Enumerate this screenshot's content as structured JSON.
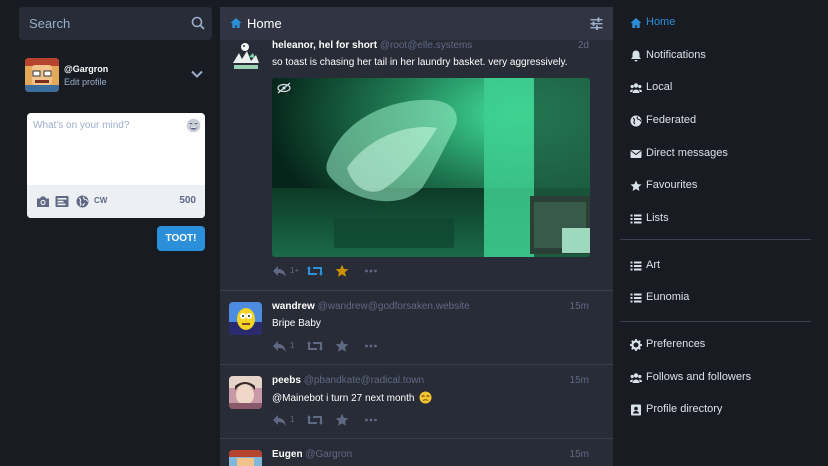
{
  "search": {
    "placeholder": "Search"
  },
  "account": {
    "handle": "@Gargron",
    "edit_label": "Edit profile"
  },
  "compose": {
    "placeholder": "What's on your mind?",
    "cw_label": "CW",
    "counter": "500",
    "submit_label": "TOOT!"
  },
  "column": {
    "title": "Home"
  },
  "statuses": [
    {
      "display_name": "heleanor, hel for short",
      "acct": "@root@elle.systems",
      "time": "2d",
      "text": "so toast is chasing her tail in her laundry basket. very aggressively.",
      "reply_count": "1+"
    },
    {
      "display_name": "wandrew",
      "acct": "@wandrew@godforsaken.website",
      "time": "15m",
      "text": "Bripe Baby",
      "reply_count": "1"
    },
    {
      "display_name": "peebs",
      "acct": "@pbandkate@radical.town",
      "time": "15m",
      "text": "@Mainebot i turn 27 next month",
      "reply_count": "1"
    },
    {
      "display_name": "Eugen",
      "acct": "@Gargron",
      "time": "15m"
    }
  ],
  "nav": {
    "home": "Home",
    "notifications": "Notifications",
    "local": "Local",
    "federated": "Federated",
    "direct": "Direct messages",
    "favourites": "Favourites",
    "lists": "Lists",
    "list_art": "Art",
    "list_eunomia": "Eunomia",
    "preferences": "Preferences",
    "follows": "Follows and followers",
    "directory": "Profile directory"
  },
  "colors": {
    "accent": "#2b90d9",
    "favourite": "#ca8f04",
    "background": "#191b22",
    "panel": "#282c37"
  }
}
